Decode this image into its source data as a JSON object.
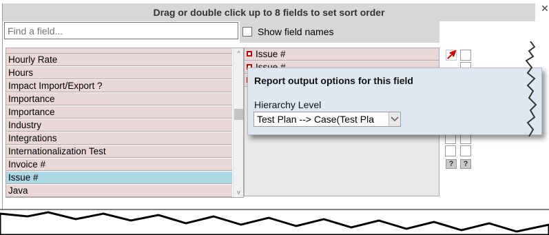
{
  "dialog": {
    "title": "Drag or double click up to 8 fields to set sort order",
    "search_placeholder": "Find a field...",
    "show_field_names_label": "Show field names"
  },
  "available_fields": {
    "partial_top": "",
    "items": [
      "Hourly Rate",
      "Hours",
      "Impact Import/Export ?",
      "Importance",
      "Importance",
      "Industry",
      "Integrations",
      "Internationalization Test",
      "Invoice #",
      "Issue #",
      "Java"
    ],
    "selected": "Issue #"
  },
  "sort_fields": {
    "items": [
      "Issue #",
      "Issue #",
      ""
    ]
  },
  "help_buttons": [
    "?",
    "?"
  ],
  "popup": {
    "title": "Report output options for this field",
    "hierarchy_label": "Hierarchy Level",
    "hierarchy_value": "Test Plan --> Case(Test Pla"
  },
  "colors": {
    "field_bg": "#ead7d9",
    "selected_bg": "#add8e6",
    "marker": "#c00000",
    "arrow": "#d40000",
    "popup_bg": "#dfe8f0",
    "title_bar": "#d7d7d7"
  },
  "icons": {
    "sort_marker": "red-square-icon",
    "move_up": "red-arrow-up-right-icon",
    "select_arrow": "chevron-down-icon",
    "scroll_up": "scroll-up-icon",
    "scroll_down": "scroll-down-icon"
  }
}
